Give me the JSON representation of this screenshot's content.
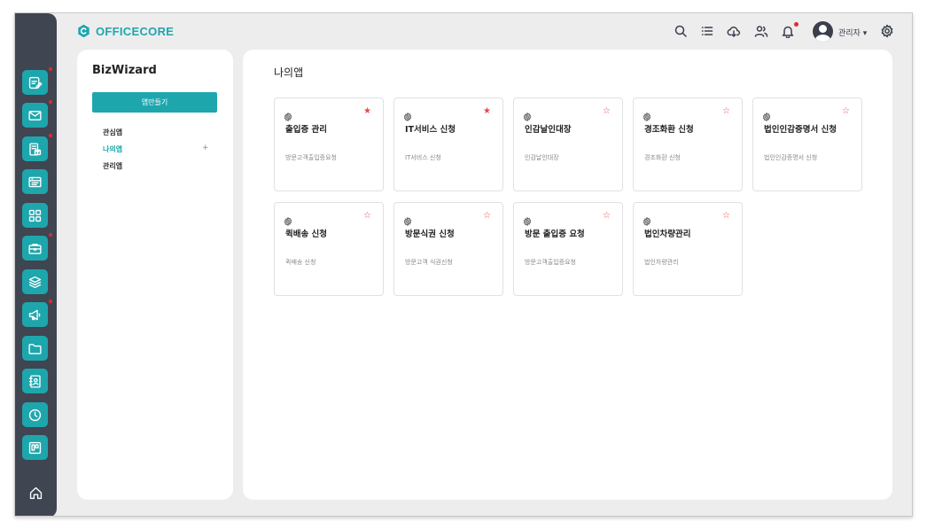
{
  "brand": {
    "name": "OFFICECORE",
    "accent": "#1ea6ad"
  },
  "rail": {
    "items": [
      {
        "icon": "edit-note-icon",
        "badge": true
      },
      {
        "icon": "mail-icon",
        "badge": true
      },
      {
        "icon": "document-mail-icon",
        "badge": true
      },
      {
        "icon": "board-icon",
        "badge": false
      },
      {
        "icon": "apps-grid-icon",
        "badge": false
      },
      {
        "icon": "briefcase-icon",
        "badge": true
      },
      {
        "icon": "layers-icon",
        "badge": false
      },
      {
        "icon": "megaphone-icon",
        "badge": true
      },
      {
        "icon": "folder-icon",
        "badge": false
      },
      {
        "icon": "contact-book-icon",
        "badge": false
      },
      {
        "icon": "clock-icon",
        "badge": false
      },
      {
        "icon": "kanban-icon",
        "badge": false
      }
    ],
    "home_icon": "home-icon"
  },
  "header": {
    "icons": [
      "search-icon",
      "list-icon",
      "cloud-download-icon",
      "users-icon",
      "bell-icon",
      "settings-icon"
    ],
    "user_label": "관리자 ▾"
  },
  "sidebar": {
    "title": "BizWizard",
    "create_button": "앱만들기",
    "items": [
      {
        "label": "관심앱",
        "active": false
      },
      {
        "label": "나의앱",
        "active": true
      },
      {
        "label": "관리앱",
        "active": false
      }
    ],
    "add_symbol": "+"
  },
  "main": {
    "title": "나의앱",
    "apps": [
      {
        "name": "출입증 관리",
        "desc": "방문고객출입증요청",
        "starred": true,
        "star": "★"
      },
      {
        "name": "IT서비스 신청",
        "desc": "IT서비스 신청",
        "starred": true,
        "star": "★"
      },
      {
        "name": "인감날인대장",
        "desc": "인감날인대장",
        "starred": false,
        "star": "☆"
      },
      {
        "name": "경조화환 신청",
        "desc": "경조화환 신청",
        "starred": false,
        "star": "☆"
      },
      {
        "name": "법인인감증명서 신청",
        "desc": "법인인감증명서 신청",
        "starred": false,
        "star": "☆"
      },
      {
        "name": "퀵배송 신청",
        "desc": "퀵배송 신청",
        "starred": false,
        "star": "☆"
      },
      {
        "name": "방문식권 신청",
        "desc": "방문고객 식권신청",
        "starred": false,
        "star": "☆"
      },
      {
        "name": "방문 출입증 요청",
        "desc": "방문고객출입증요청",
        "starred": false,
        "star": "☆"
      },
      {
        "name": "법인차량관리",
        "desc": "법인차량관리",
        "starred": false,
        "star": "☆"
      }
    ]
  }
}
